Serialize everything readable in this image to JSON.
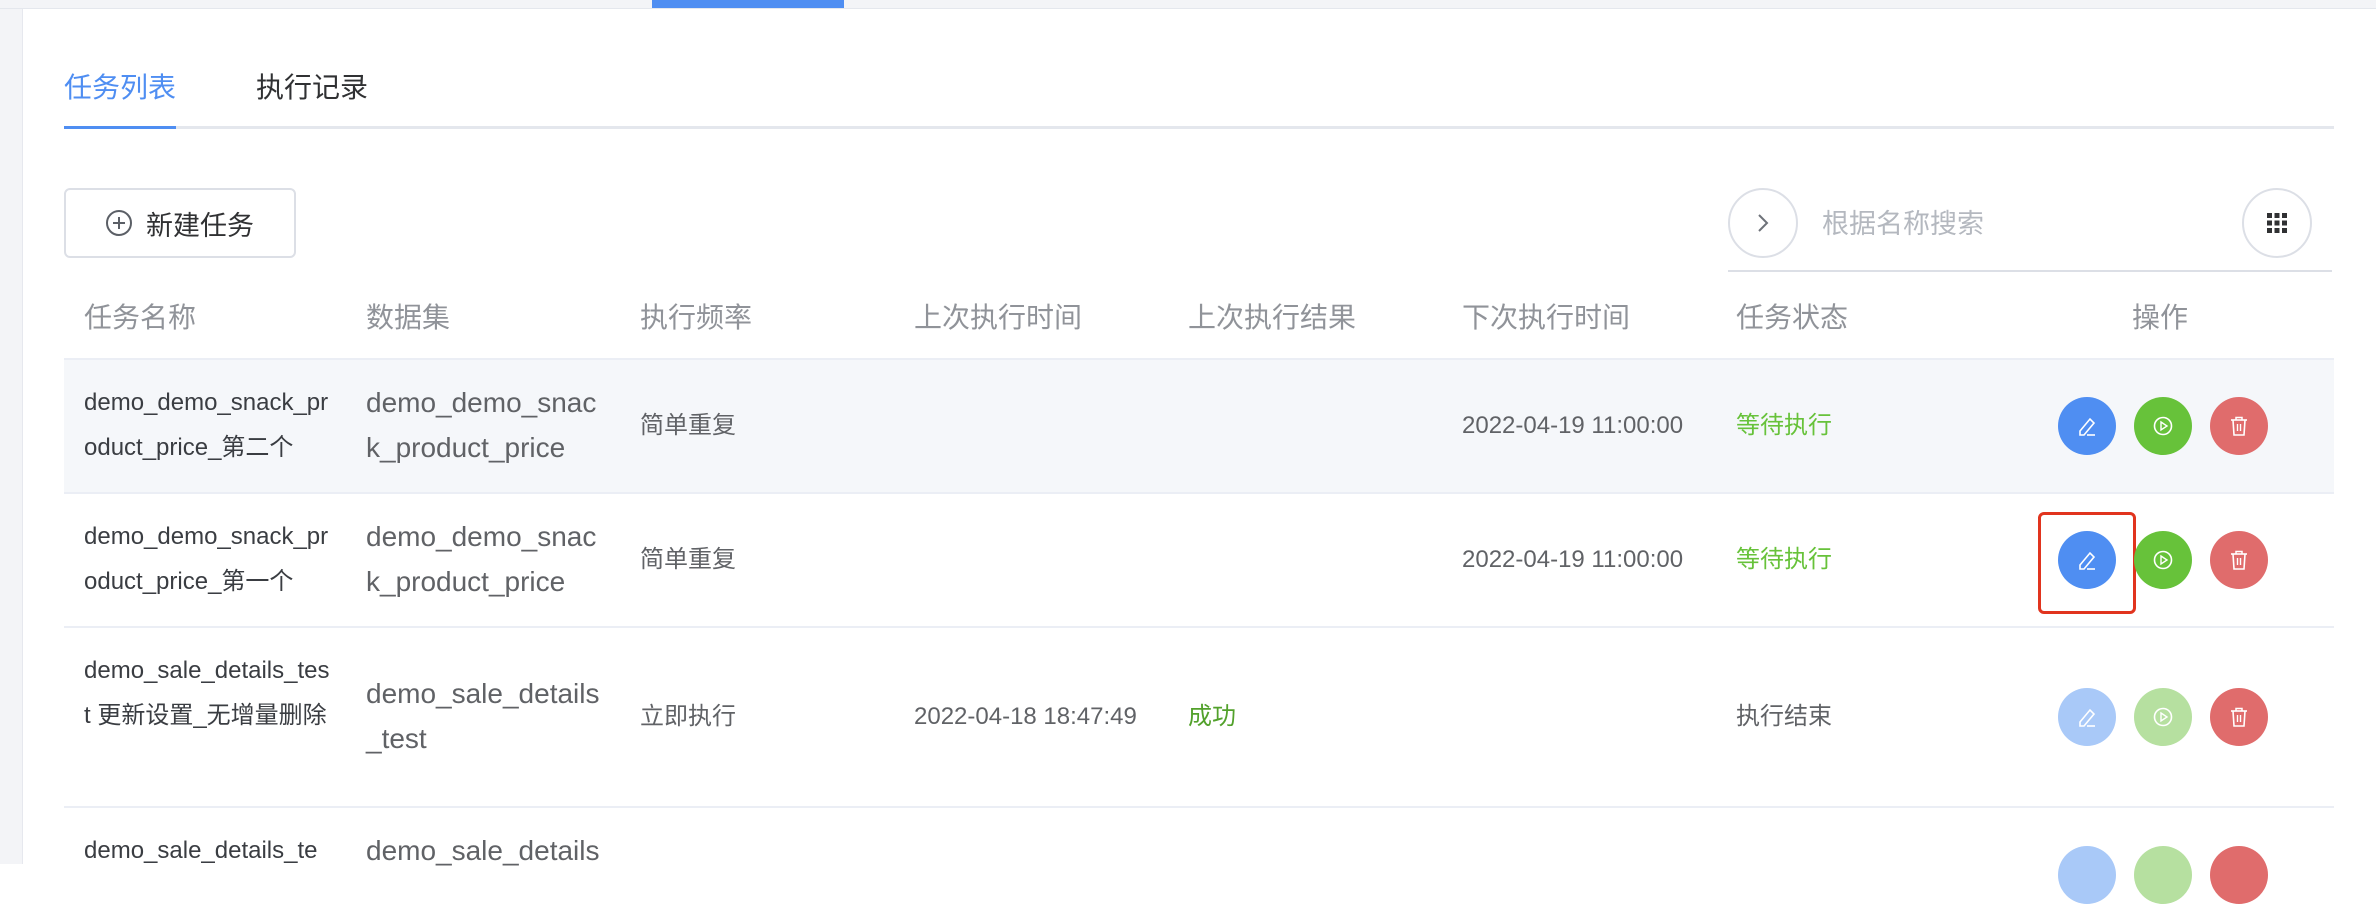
{
  "tabs": [
    {
      "label": "任务列表",
      "active": true
    },
    {
      "label": "执行记录",
      "active": false
    }
  ],
  "toolbar": {
    "new_task_label": "新建任务",
    "search_placeholder": "根据名称搜索"
  },
  "table": {
    "headers": {
      "name": "任务名称",
      "dataset": "数据集",
      "frequency": "执行频率",
      "last_time": "上次执行时间",
      "last_result": "上次执行结果",
      "next_time": "下次执行时间",
      "status": "任务状态",
      "actions": "操作"
    },
    "rows": [
      {
        "name": "demo_demo_snack_product_price_第二个",
        "dataset": "demo_demo_snack_product_price",
        "frequency": "简单重复",
        "last_time": "",
        "last_result": "",
        "next_time": "2022-04-19 11:00:00",
        "status": "等待执行"
      },
      {
        "name": "demo_demo_snack_product_price_第一个",
        "dataset": "demo_demo_snack_product_price",
        "frequency": "简单重复",
        "last_time": "",
        "last_result": "",
        "next_time": "2022-04-19 11:00:00",
        "status": "等待执行"
      },
      {
        "name": "demo_sale_details_test 更新设置_无增量删除",
        "dataset": "demo_sale_details_test",
        "frequency": "立即执行",
        "last_time": "2022-04-18 18:47:49",
        "last_result": "成功",
        "next_time": "",
        "status": "执行结束"
      },
      {
        "name": "demo_sale_details_te",
        "dataset": "demo_sale_details",
        "frequency": "",
        "last_time": "",
        "last_result": "",
        "next_time": "",
        "status": ""
      }
    ]
  },
  "icons": {
    "new": "plus-circle-icon",
    "expand": "chevron-right-icon",
    "grid": "grid-icon",
    "edit": "pencil-icon",
    "run": "play-icon",
    "delete": "trash-icon"
  },
  "colors": {
    "primary": "#4f8ef2",
    "success": "#67c23a",
    "danger": "#e06c6c",
    "highlight": "#e1341e"
  }
}
